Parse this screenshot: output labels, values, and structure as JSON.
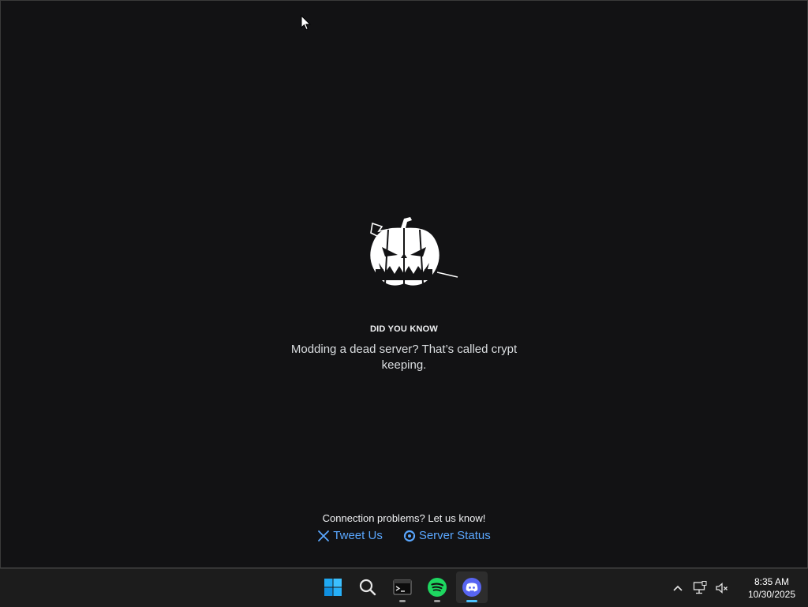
{
  "loading": {
    "heading": "DID YOU KNOW",
    "tip": "Modding a dead server? That’s called crypt keeping.",
    "illustration_icon": "jack-o-lantern-icon"
  },
  "connection": {
    "message": "Connection problems? Let us know!",
    "tweet_label": "Tweet Us",
    "status_label": "Server Status"
  },
  "taskbar": {
    "apps": [
      "start-icon",
      "search-icon",
      "terminal-icon",
      "spotify-icon",
      "discord-icon"
    ],
    "active_app": "discord",
    "time": "8:35 AM",
    "date": "10/30/2025"
  },
  "colors": {
    "window_bg": "#121214",
    "link": "#5aa7ff",
    "discord": "#5865f2",
    "spotify": "#1ed760",
    "active_indicator": "#4cc2ff"
  }
}
